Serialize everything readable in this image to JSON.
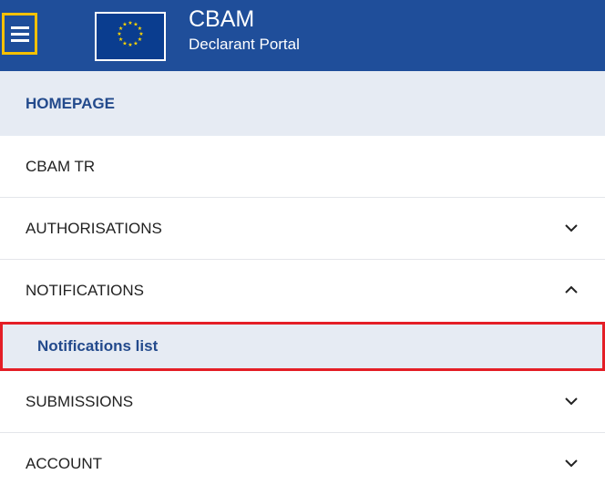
{
  "header": {
    "title": "CBAM",
    "subtitle": "Declarant Portal",
    "menu_icon": "hamburger-menu-icon",
    "logo_icon": "eu-flag-icon",
    "accent_color": "#1f4e9a",
    "menu_border_color": "#f5c000"
  },
  "nav": {
    "home": "HOMEPAGE",
    "items": [
      {
        "label": "CBAM TR"
      },
      {
        "label": "AUTHORISATIONS",
        "icon": "chevron-down-icon"
      },
      {
        "label": "NOTIFICATIONS",
        "icon": "chevron-up-icon"
      },
      {
        "label": "SUBMISSIONS",
        "icon": "chevron-down-icon"
      },
      {
        "label": "ACCOUNT",
        "icon": "chevron-down-icon"
      }
    ],
    "sub_items": [
      {
        "label": "Notifications list",
        "highlight_color": "#e41e26"
      }
    ]
  }
}
